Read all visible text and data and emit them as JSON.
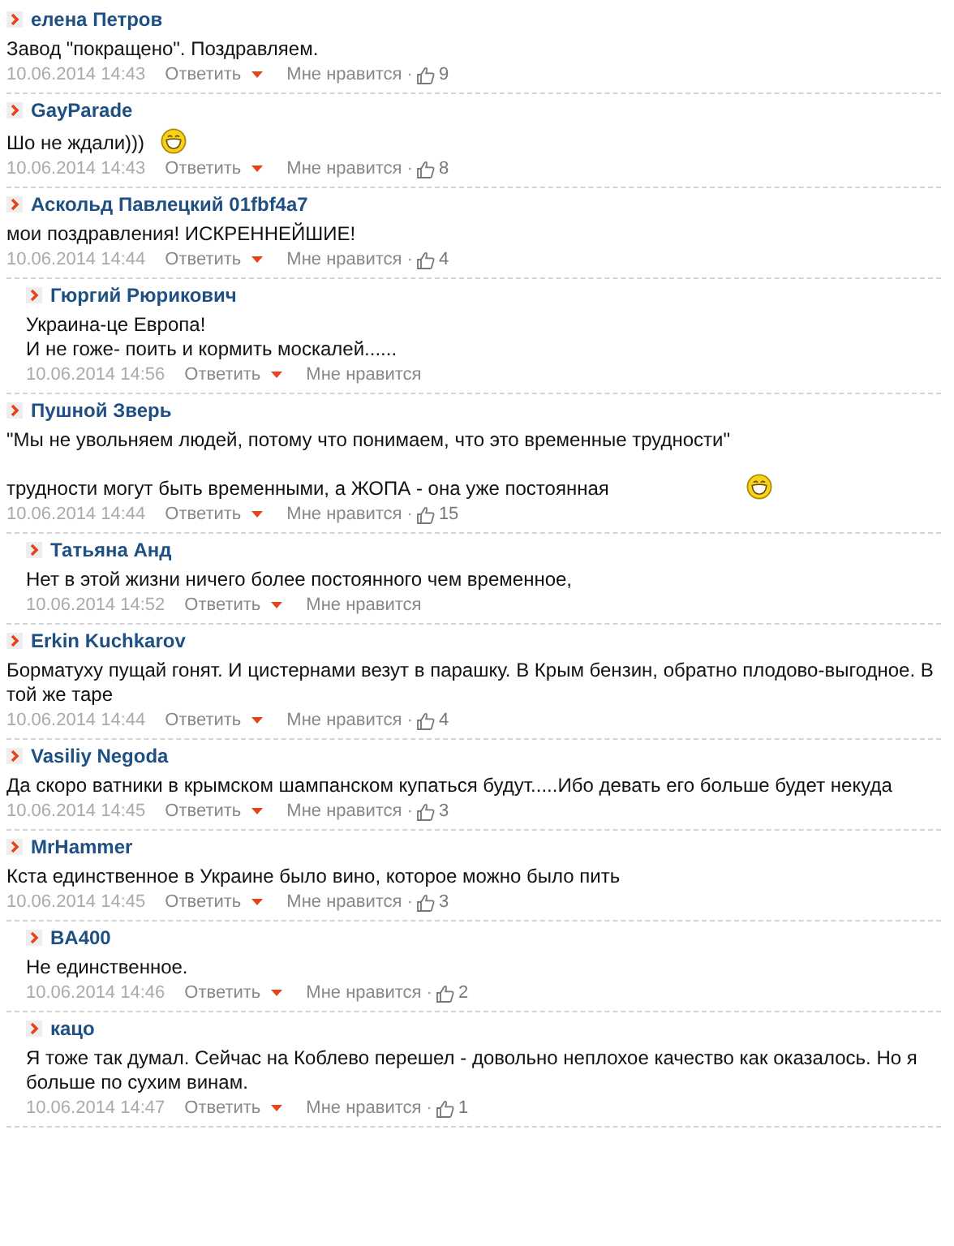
{
  "comments": [
    {
      "author": "елена Петров",
      "text": "Завод \"покращено\". Поздравляем.",
      "emoticon": false,
      "date": "10.06.2014 14:43",
      "reply_label": "Ответить",
      "like_label": "Мне нравится",
      "like_dot": "·",
      "likes": "9"
    },
    {
      "author": "GayParade",
      "text": "Шо не ждали)))",
      "emoticon": true,
      "date": "10.06.2014 14:43",
      "reply_label": "Ответить",
      "like_label": "Мне нравится",
      "like_dot": "·",
      "likes": "8"
    },
    {
      "author": "Аскольд Павлецкий 01fbf4a7",
      "text": "мои поздравления! ИСКРЕННЕЙШИЕ!",
      "emoticon": false,
      "date": "10.06.2014 14:44",
      "reply_label": "Ответить",
      "like_label": "Мне нравится",
      "like_dot": "·",
      "likes": "4",
      "replies": [
        {
          "author": "Гюргий Рюрикович",
          "text": "Украина-це Европа!\nИ не гоже- поить и кормить москалей......",
          "emoticon": false,
          "date": "10.06.2014 14:56",
          "reply_label": "Ответить",
          "like_label": "Мне нравится"
        }
      ]
    },
    {
      "author": "Пушной Зверь",
      "text": "\"Мы не увольняем людей, потому что понимаем, что это временные трудности\"\n\nтрудности могут быть временными, а ЖОПА - она уже постоянная",
      "emoticon": true,
      "date": "10.06.2014 14:44",
      "reply_label": "Ответить",
      "like_label": "Мне нравится",
      "like_dot": "·",
      "likes": "15",
      "replies": [
        {
          "author": "Татьяна Анд",
          "text": "Нет в этой жизни ничего более постоянного чем временное,",
          "emoticon": false,
          "date": "10.06.2014 14:52",
          "reply_label": "Ответить",
          "like_label": "Мне нравится"
        }
      ]
    },
    {
      "author": "Erkin Kuchkarov",
      "text": "Борматуху пущай гонят. И цистернами везут в парашку. В Крым бензин, обратно плодово-выгодное. В той же таре",
      "emoticon": false,
      "date": "10.06.2014 14:44",
      "reply_label": "Ответить",
      "like_label": "Мне нравится",
      "like_dot": "·",
      "likes": "4"
    },
    {
      "author": "Vasiliy Negoda",
      "text": "Да скоро ватники в крымском шампанском купаться будут.....Ибо девать его больше будет некуда",
      "emoticon": false,
      "date": "10.06.2014 14:45",
      "reply_label": "Ответить",
      "like_label": "Мне нравится",
      "like_dot": "·",
      "likes": "3"
    },
    {
      "author": "MrHammer",
      "text": "Кста единственное в Украине было вино, которое можно было пить",
      "emoticon": false,
      "date": "10.06.2014 14:45",
      "reply_label": "Ответить",
      "like_label": "Мне нравится",
      "like_dot": "·",
      "likes": "3",
      "replies": [
        {
          "author": "BA400",
          "text": "Не единственное.",
          "emoticon": false,
          "date": "10.06.2014 14:46",
          "reply_label": "Ответить",
          "like_label": "Мне нравится",
          "like_dot": "·",
          "likes": "2"
        },
        {
          "author": "кацо",
          "text": "Я тоже так думал. Сейчас на Коблево перешел - довольно неплохое качество как оказалось. Но я больше по сухим винам.",
          "emoticon": false,
          "date": "10.06.2014 14:47",
          "reply_label": "Ответить",
          "like_label": "Мне нравится",
          "like_dot": "·",
          "likes": "1"
        }
      ]
    }
  ]
}
